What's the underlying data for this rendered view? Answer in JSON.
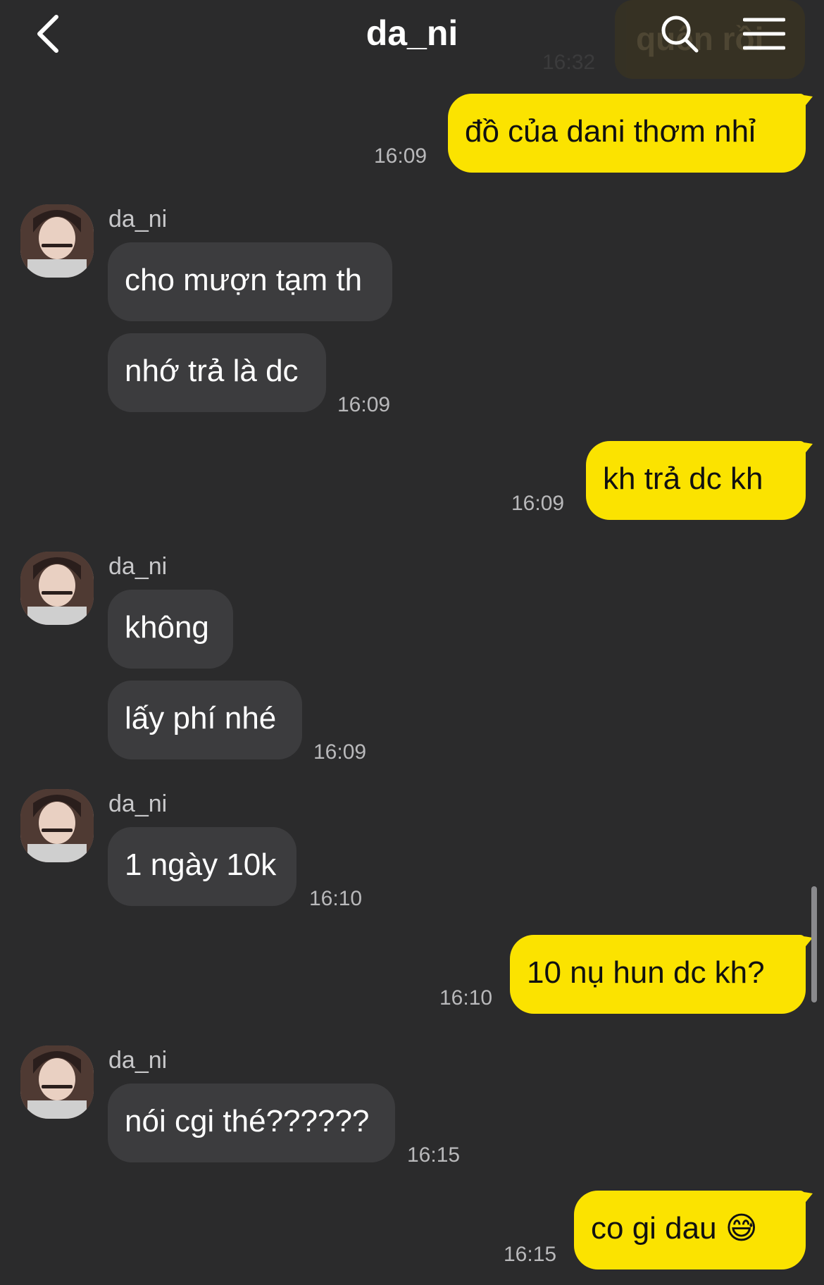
{
  "header": {
    "title": "da_ni",
    "ghost_text": "quên rồi",
    "ghost_time": "16:32"
  },
  "messages": [
    {
      "dir": "out",
      "text": "đồ của dani thơm nhỉ",
      "time": "16:09"
    },
    {
      "dir": "in",
      "sender": "da_ni",
      "text": "cho mượn tạm th"
    },
    {
      "dir": "in",
      "text": "nhớ trả là dc",
      "time": "16:09"
    },
    {
      "dir": "out",
      "text": "kh trả dc kh",
      "time": "16:09"
    },
    {
      "dir": "in",
      "sender": "da_ni",
      "text": "không"
    },
    {
      "dir": "in",
      "text": "lấy phí nhé",
      "time": "16:09"
    },
    {
      "dir": "in",
      "sender": "da_ni",
      "text": "1 ngày 10k",
      "time": "16:10"
    },
    {
      "dir": "out",
      "text": "10 nụ hun dc kh?",
      "time": "16:10"
    },
    {
      "dir": "in",
      "sender": "da_ni",
      "text": "nói cgi thé??????",
      "time": "16:15"
    },
    {
      "dir": "out",
      "text": "co gi dau 😅",
      "time": "16:15"
    }
  ]
}
